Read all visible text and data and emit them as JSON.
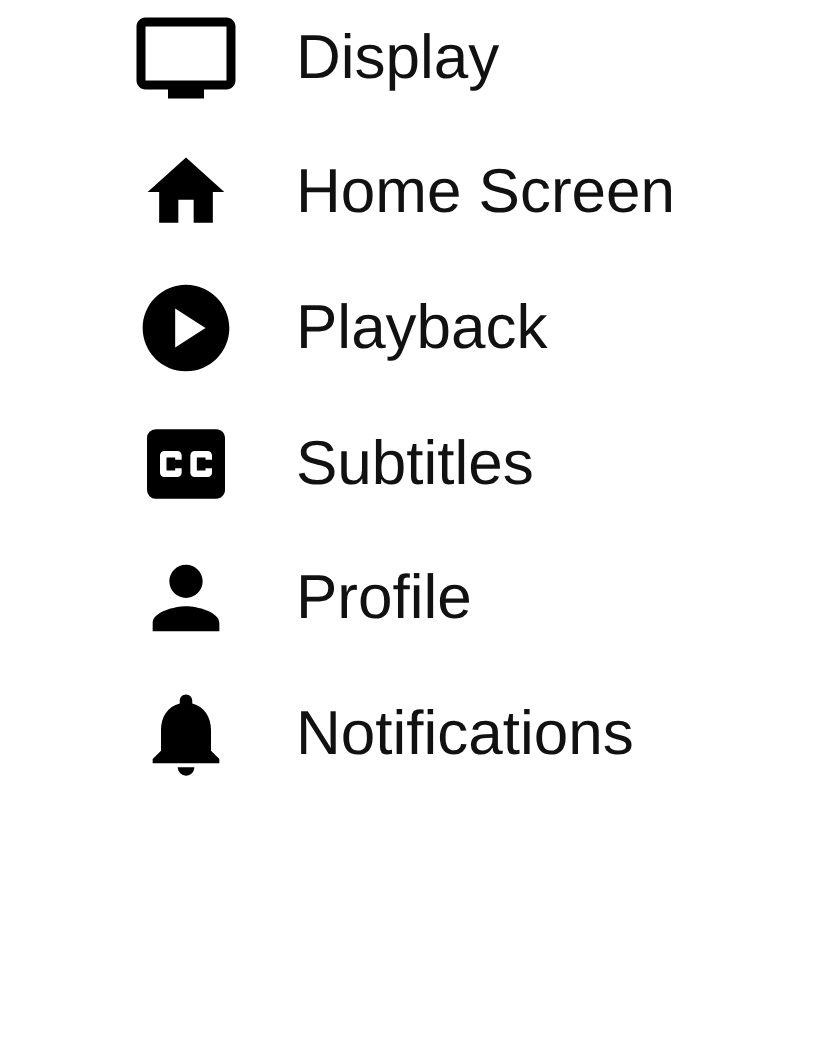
{
  "menu": {
    "items": [
      {
        "label": "Display"
      },
      {
        "label": "Home Screen"
      },
      {
        "label": "Playback"
      },
      {
        "label": "Subtitles"
      },
      {
        "label": "Profile"
      },
      {
        "label": "Notifications"
      }
    ]
  }
}
